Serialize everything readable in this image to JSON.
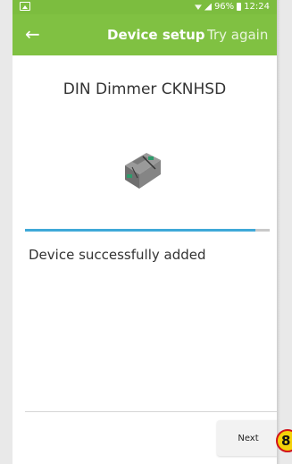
{
  "status_bar": {
    "battery_text": "96%",
    "time": "12:24",
    "left_icon": "image-icon"
  },
  "app_bar": {
    "back_icon": "arrow-left-icon",
    "title": "Device setup",
    "action_label": "Try again"
  },
  "device": {
    "name": "DIN Dimmer CKNHSD",
    "image_icon": "din-rail-dimmer-icon"
  },
  "progress": {
    "fraction": 0.94
  },
  "status_message": "Device successfully added",
  "footer": {
    "next_label": "Next"
  },
  "step_badge": {
    "label": "8"
  },
  "colors": {
    "accent_green": "#80c142",
    "progress_blue": "#3fa9d8",
    "badge_yellow": "#f5d20a",
    "badge_red": "#d1131a"
  }
}
